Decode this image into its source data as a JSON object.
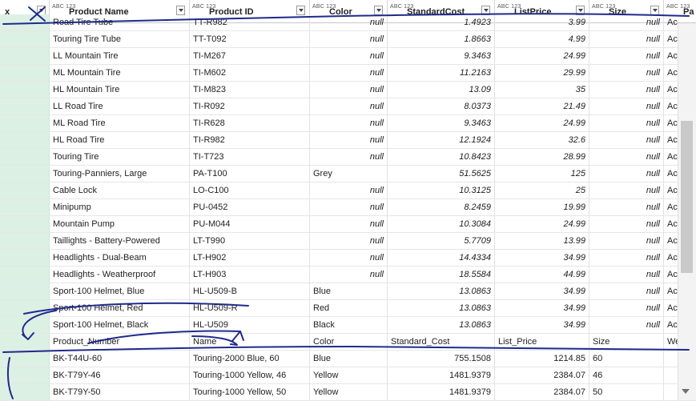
{
  "columns": [
    {
      "type": "",
      "label": "x"
    },
    {
      "type": "ABC 123",
      "label": "Product Name"
    },
    {
      "type": "ABC 123",
      "label": "Product ID"
    },
    {
      "type": "ABC 123",
      "label": "Color"
    },
    {
      "type": "ABC 123",
      "label": "StandardCost"
    },
    {
      "type": "ABC 123",
      "label": "ListPrice"
    },
    {
      "type": "ABC 123",
      "label": "Size"
    },
    {
      "type": "ABC 123",
      "label": "Pa"
    }
  ],
  "rows": [
    {
      "name": "Road Tire Tube",
      "id": "TT-R982",
      "color": "null",
      "cost": "1.4923",
      "price": "3.99",
      "size": "null",
      "extra": "Ac"
    },
    {
      "name": "Touring Tire Tube",
      "id": "TT-T092",
      "color": "null",
      "cost": "1.8663",
      "price": "4.99",
      "size": "null",
      "extra": "Ac"
    },
    {
      "name": "LL Mountain Tire",
      "id": "TI-M267",
      "color": "null",
      "cost": "9.3463",
      "price": "24.99",
      "size": "null",
      "extra": "Ac"
    },
    {
      "name": "ML Mountain Tire",
      "id": "TI-M602",
      "color": "null",
      "cost": "11.2163",
      "price": "29.99",
      "size": "null",
      "extra": "Ac"
    },
    {
      "name": "HL Mountain Tire",
      "id": "TI-M823",
      "color": "null",
      "cost": "13.09",
      "price": "35",
      "size": "null",
      "extra": "Ac"
    },
    {
      "name": "LL Road Tire",
      "id": "TI-R092",
      "color": "null",
      "cost": "8.0373",
      "price": "21.49",
      "size": "null",
      "extra": "Ac"
    },
    {
      "name": "ML Road Tire",
      "id": "TI-R628",
      "color": "null",
      "cost": "9.3463",
      "price": "24.99",
      "size": "null",
      "extra": "Ac"
    },
    {
      "name": "HL Road Tire",
      "id": "TI-R982",
      "color": "null",
      "cost": "12.1924",
      "price": "32.6",
      "size": "null",
      "extra": "Ac"
    },
    {
      "name": "Touring Tire",
      "id": "TI-T723",
      "color": "null",
      "cost": "10.8423",
      "price": "28.99",
      "size": "null",
      "extra": "Ac"
    },
    {
      "name": "Touring-Panniers, Large",
      "id": "PA-T100",
      "color": "Grey",
      "cost": "51.5625",
      "price": "125",
      "size": "null",
      "extra": "Ac"
    },
    {
      "name": "Cable Lock",
      "id": "LO-C100",
      "color": "null",
      "cost": "10.3125",
      "price": "25",
      "size": "null",
      "extra": "Ac"
    },
    {
      "name": "Minipump",
      "id": "PU-0452",
      "color": "null",
      "cost": "8.2459",
      "price": "19.99",
      "size": "null",
      "extra": "Ac"
    },
    {
      "name": "Mountain Pump",
      "id": "PU-M044",
      "color": "null",
      "cost": "10.3084",
      "price": "24.99",
      "size": "null",
      "extra": "Ac"
    },
    {
      "name": "Taillights - Battery-Powered",
      "id": "LT-T990",
      "color": "null",
      "cost": "5.7709",
      "price": "13.99",
      "size": "null",
      "extra": "Ac"
    },
    {
      "name": "Headlights - Dual-Beam",
      "id": "LT-H902",
      "color": "null",
      "cost": "14.4334",
      "price": "34.99",
      "size": "null",
      "extra": "Ac"
    },
    {
      "name": "Headlights - Weatherproof",
      "id": "LT-H903",
      "color": "null",
      "cost": "18.5584",
      "price": "44.99",
      "size": "null",
      "extra": "Ac"
    },
    {
      "name": "Sport-100 Helmet, Blue",
      "id": "HL-U509-B",
      "color": "Blue",
      "cost": "13.0863",
      "price": "34.99",
      "size": "null",
      "extra": "Ac"
    },
    {
      "name": "Sport-100 Helmet, Red",
      "id": "HL-U509-R",
      "color": "Red",
      "cost": "13.0863",
      "price": "34.99",
      "size": "null",
      "extra": "Ac"
    },
    {
      "name": "Sport-100 Helmet, Black",
      "id": "HL-U509",
      "color": "Black",
      "cost": "13.0863",
      "price": "34.99",
      "size": "null",
      "extra": "Ac"
    }
  ],
  "embedded_header": {
    "name": "Product_Number",
    "id": "Name",
    "color": "Color",
    "cost": "Standard_Cost",
    "price": "List_Price",
    "size": "Size",
    "extra": "We"
  },
  "embedded_rows": [
    {
      "name": "BK-T44U-60",
      "id": "Touring-2000 Blue, 60",
      "color": "Blue",
      "cost": "755.1508",
      "price": "1214.85",
      "size": "60",
      "extra": ""
    },
    {
      "name": "BK-T79Y-46",
      "id": "Touring-1000 Yellow, 46",
      "color": "Yellow",
      "cost": "1481.9379",
      "price": "2384.07",
      "size": "46",
      "extra": ""
    },
    {
      "name": "BK-T79Y-50",
      "id": "Touring-1000 Yellow, 50",
      "color": "Yellow",
      "cost": "1481.9379",
      "price": "2384.07",
      "size": "50",
      "extra": ""
    }
  ],
  "colors": {
    "index_bg": "#ddf0e4",
    "ink": "#1f2a8c",
    "scroll_thumb": "#c9c9c9"
  }
}
